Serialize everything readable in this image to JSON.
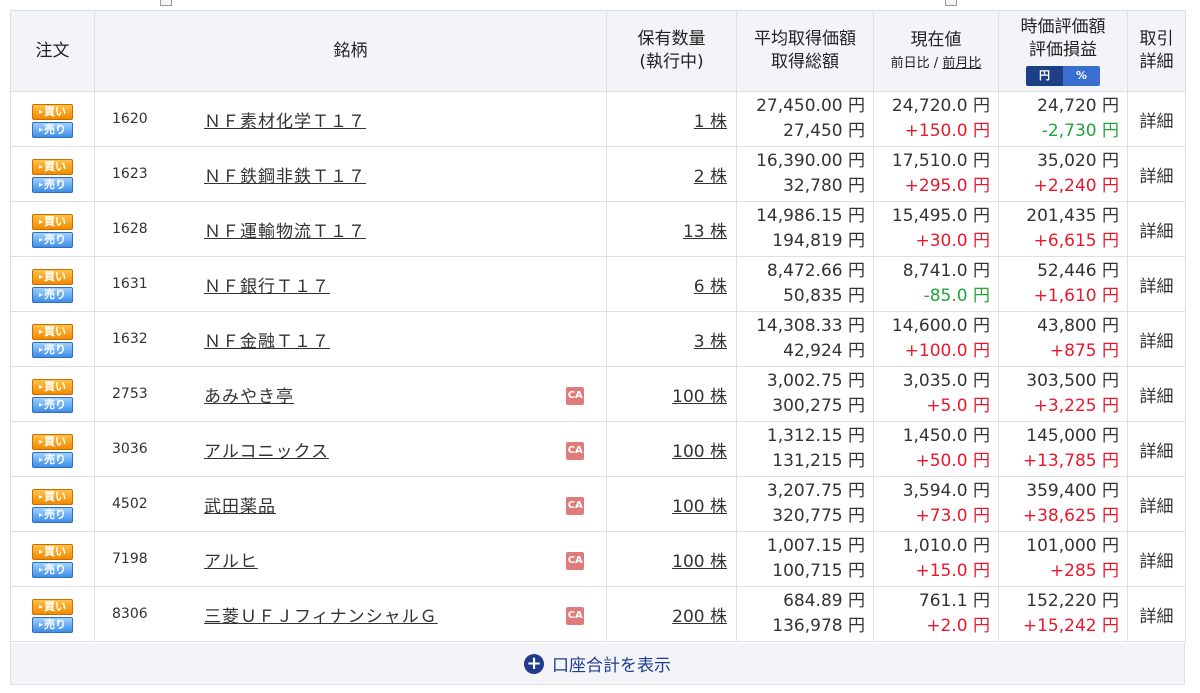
{
  "header": {
    "order": "注文",
    "meigara": "銘柄",
    "qty_line1": "保有数量",
    "qty_line2": "(執行中)",
    "avg_line1": "平均取得価額",
    "avg_line2": "取得総額",
    "price_line1": "現在値",
    "price_sub_a": "前日比",
    "price_sub_sep": " / ",
    "price_sub_b": "前月比",
    "value_line1": "時価評価額",
    "value_line2": "評価損益",
    "toggle_yen": "円",
    "toggle_pct": "%",
    "detail_line1": "取引",
    "detail_line2": "詳細"
  },
  "buttons": {
    "buy": "買い",
    "sell": "売り",
    "detail": "詳細"
  },
  "ca_label": "CA",
  "rows": [
    {
      "code": "1620",
      "name": "ＮＦ素材化学Ｔ１７",
      "ca": false,
      "qty": "1 株",
      "avg": "27,450.00 円",
      "total": "27,450 円",
      "price": "24,720.0 円",
      "change": "+150.0 円",
      "change_sign": "pos",
      "value": "24,720 円",
      "pl": "-2,730 円",
      "pl_sign": "neg"
    },
    {
      "code": "1623",
      "name": "ＮＦ鉄鋼非鉄Ｔ１７",
      "ca": false,
      "qty": "2 株",
      "avg": "16,390.00 円",
      "total": "32,780 円",
      "price": "17,510.0 円",
      "change": "+295.0 円",
      "change_sign": "pos",
      "value": "35,020 円",
      "pl": "+2,240 円",
      "pl_sign": "pos"
    },
    {
      "code": "1628",
      "name": "ＮＦ運輸物流Ｔ１７",
      "ca": false,
      "qty": "13 株",
      "avg": "14,986.15 円",
      "total": "194,819 円",
      "price": "15,495.0 円",
      "change": "+30.0 円",
      "change_sign": "pos",
      "value": "201,435 円",
      "pl": "+6,615 円",
      "pl_sign": "pos"
    },
    {
      "code": "1631",
      "name": "ＮＦ銀行Ｔ１７",
      "ca": false,
      "qty": "6 株",
      "avg": "8,472.66 円",
      "total": "50,835 円",
      "price": "8,741.0 円",
      "change": "-85.0 円",
      "change_sign": "neg",
      "value": "52,446 円",
      "pl": "+1,610 円",
      "pl_sign": "pos"
    },
    {
      "code": "1632",
      "name": "ＮＦ金融Ｔ１７",
      "ca": false,
      "qty": "3 株",
      "avg": "14,308.33 円",
      "total": "42,924 円",
      "price": "14,600.0 円",
      "change": "+100.0 円",
      "change_sign": "pos",
      "value": "43,800 円",
      "pl": "+875 円",
      "pl_sign": "pos"
    },
    {
      "code": "2753",
      "name": "あみやき亭",
      "ca": true,
      "qty": "100 株",
      "avg": "3,002.75 円",
      "total": "300,275 円",
      "price": "3,035.0 円",
      "change": "+5.0 円",
      "change_sign": "pos",
      "value": "303,500 円",
      "pl": "+3,225 円",
      "pl_sign": "pos"
    },
    {
      "code": "3036",
      "name": "アルコニックス",
      "ca": true,
      "qty": "100 株",
      "avg": "1,312.15 円",
      "total": "131,215 円",
      "price": "1,450.0 円",
      "change": "+50.0 円",
      "change_sign": "pos",
      "value": "145,000 円",
      "pl": "+13,785 円",
      "pl_sign": "pos"
    },
    {
      "code": "4502",
      "name": "武田薬品",
      "ca": true,
      "qty": "100 株",
      "avg": "3,207.75 円",
      "total": "320,775 円",
      "price": "3,594.0 円",
      "change": "+73.0 円",
      "change_sign": "pos",
      "value": "359,400 円",
      "pl": "+38,625 円",
      "pl_sign": "pos"
    },
    {
      "code": "7198",
      "name": "アルヒ",
      "ca": true,
      "qty": "100 株",
      "avg": "1,007.15 円",
      "total": "100,715 円",
      "price": "1,010.0 円",
      "change": "+15.0 円",
      "change_sign": "pos",
      "value": "101,000 円",
      "pl": "+285 円",
      "pl_sign": "pos"
    },
    {
      "code": "8306",
      "name": "三菱ＵＦＪフィナンシャルＧ",
      "ca": true,
      "qty": "200 株",
      "avg": "684.89 円",
      "total": "136,978 円",
      "price": "761.1 円",
      "change": "+2.0 円",
      "change_sign": "pos",
      "value": "152,220 円",
      "pl": "+15,242 円",
      "pl_sign": "pos"
    }
  ],
  "footer": {
    "show_total": "口座合計を表示"
  },
  "colors": {
    "positive": "#e8182c",
    "negative": "#22a43a",
    "accent": "#1f3d8c"
  }
}
